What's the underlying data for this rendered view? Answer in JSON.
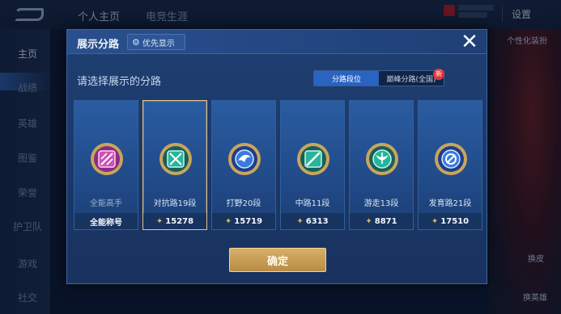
{
  "background": {
    "tabs": [
      "个人主页",
      "电竞生涯"
    ],
    "settings_label": "设置",
    "sidebar": [
      {
        "label": "主页",
        "active": true
      },
      {
        "label": "战绩",
        "active": false
      },
      {
        "label": "英雄",
        "active": false
      },
      {
        "label": "图鉴",
        "active": false
      },
      {
        "label": "荣誉",
        "active": false
      },
      {
        "label": "护卫队",
        "active": false
      },
      {
        "label": "游戏",
        "active": false
      },
      {
        "label": "社交",
        "active": false
      }
    ],
    "hero_panel": {
      "label": "个性化装扮",
      "buttons": [
        "换皮",
        "换英雄"
      ]
    }
  },
  "modal": {
    "title": "展示分路",
    "priority_button": "优先显示",
    "prompt": "请选择展示的分路",
    "segments": [
      {
        "label": "分路段位",
        "active": true
      },
      {
        "label": "巅峰分路(全国)",
        "active": false
      }
    ],
    "new_badge": "新",
    "cards": [
      {
        "name": "全能高手",
        "footer": "全能称号",
        "score": "",
        "selected": false,
        "icon": "all-round-emblem-icon",
        "color": "#d24fb7"
      },
      {
        "name": "对抗路19段",
        "footer": "",
        "score": "15278",
        "selected": true,
        "icon": "clash-lane-emblem-icon",
        "color": "#27b49c"
      },
      {
        "name": "打野20段",
        "footer": "",
        "score": "15719",
        "selected": false,
        "icon": "jungle-emblem-icon",
        "color": "#3a7be0"
      },
      {
        "name": "中路11段",
        "footer": "",
        "score": "6313",
        "selected": false,
        "icon": "mid-lane-emblem-icon",
        "color": "#27b49c"
      },
      {
        "name": "游走13段",
        "footer": "",
        "score": "8871",
        "selected": false,
        "icon": "roam-emblem-icon",
        "color": "#27b49c"
      },
      {
        "name": "发育路21段",
        "footer": "",
        "score": "17510",
        "selected": false,
        "icon": "farm-lane-emblem-icon",
        "color": "#3a7be0"
      }
    ],
    "confirm_label": "确定"
  }
}
